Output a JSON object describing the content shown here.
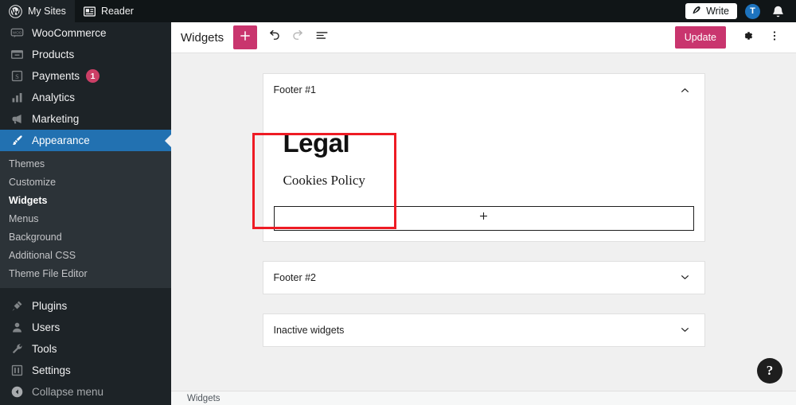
{
  "adminbar": {
    "wp_logo_icon": "wordpress-logo-icon",
    "my_sites_label": "My Sites",
    "reader_icon": "reader-icon",
    "reader_label": "Reader",
    "write_icon": "pencil-icon",
    "write_label": "Write",
    "avatar_initial": "T",
    "avatar_color": "#1d73be",
    "bell_icon": "bell-icon"
  },
  "sidebar": {
    "items": [
      {
        "label": "WooCommerce",
        "icon": "woocommerce-icon",
        "badge": null,
        "current": false
      },
      {
        "label": "Products",
        "icon": "products-box-icon",
        "badge": null,
        "current": false
      },
      {
        "label": "Payments",
        "icon": "payments-card-icon",
        "badge": "1",
        "current": false
      },
      {
        "label": "Analytics",
        "icon": "analytics-bar-chart-icon",
        "badge": null,
        "current": false
      },
      {
        "label": "Marketing",
        "icon": "marketing-megaphone-icon",
        "badge": null,
        "current": false
      },
      {
        "label": "Appearance",
        "icon": "appearance-brush-icon",
        "badge": null,
        "current": true
      }
    ],
    "submenu": [
      {
        "label": "Themes",
        "current": false
      },
      {
        "label": "Customize",
        "current": false
      },
      {
        "label": "Widgets",
        "current": true
      },
      {
        "label": "Menus",
        "current": false
      },
      {
        "label": "Background",
        "current": false
      },
      {
        "label": "Additional CSS",
        "current": false
      },
      {
        "label": "Theme File Editor",
        "current": false
      }
    ],
    "items_bottom": [
      {
        "label": "Plugins",
        "icon": "plugins-plug-icon"
      },
      {
        "label": "Users",
        "icon": "users-person-icon"
      },
      {
        "label": "Tools",
        "icon": "tools-wrench-icon"
      },
      {
        "label": "Settings",
        "icon": "settings-sliders-icon"
      }
    ],
    "collapse": {
      "label": "Collapse menu",
      "icon": "collapse-arrow-left-icon"
    },
    "active_color": "#2271b1",
    "badge_color": "#cc3f66"
  },
  "editor_header": {
    "title": "Widgets",
    "add_block_icon": "plus-icon",
    "undo_icon": "undo-arrow-icon",
    "redo_icon": "redo-arrow-icon",
    "redo_disabled": true,
    "list_view_icon": "list-view-icon",
    "update_label": "Update",
    "settings_icon": "gear-icon",
    "more_menu_icon": "three-dots-vertical-icon",
    "accent_color": "#c9356e"
  },
  "panels": [
    {
      "title": "Footer #1",
      "expanded": true,
      "chevron_icon": "chevron-up-icon",
      "blocks": {
        "heading": "Legal",
        "link": "Cookies Policy",
        "appender_icon": "plus-icon"
      }
    },
    {
      "title": "Footer #2",
      "expanded": false,
      "chevron_icon": "chevron-down-icon"
    },
    {
      "title": "Inactive widgets",
      "expanded": false,
      "chevron_icon": "chevron-down-icon"
    }
  ],
  "annotation": {
    "color": "#ee1b24",
    "target": "legal-widget-block"
  },
  "help_button": {
    "glyph": "?",
    "icon": "help-question-icon"
  },
  "statusbar": {
    "breadcrumb": "Widgets"
  }
}
